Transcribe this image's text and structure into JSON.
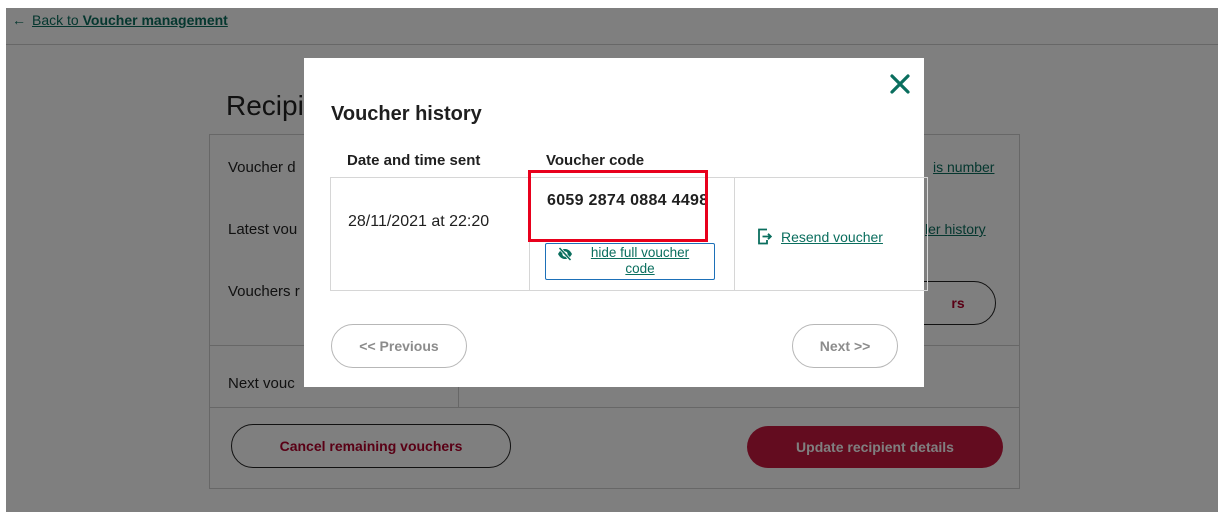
{
  "back_link": {
    "prefix": "Back to ",
    "target": "Voucher management"
  },
  "background": {
    "title": "Recipi",
    "rows": [
      {
        "label": "Voucher d",
        "link": "is number"
      },
      {
        "label": "Latest vou",
        "link": "ler history"
      },
      {
        "label": "Vouchers r",
        "button": "rs"
      },
      {
        "label": "Next vouc"
      }
    ],
    "cancel_button": "Cancel remaining vouchers",
    "update_button": "Update recipient details"
  },
  "modal": {
    "title": "Voucher history",
    "columns": {
      "date": "Date and time sent",
      "code": "Voucher code"
    },
    "row": {
      "date": "28/11/2021 at 22:20",
      "code": "6059 2874 0884 4498",
      "hide_label": "hide full voucher code",
      "resend_label": "Resend voucher"
    },
    "pager": {
      "previous": "<< Previous",
      "next": "Next >>"
    }
  },
  "colors": {
    "accent": "#0a6e5e",
    "highlight": "#e8001c",
    "danger": "#c7193f",
    "link_border": "#1d70b8"
  }
}
